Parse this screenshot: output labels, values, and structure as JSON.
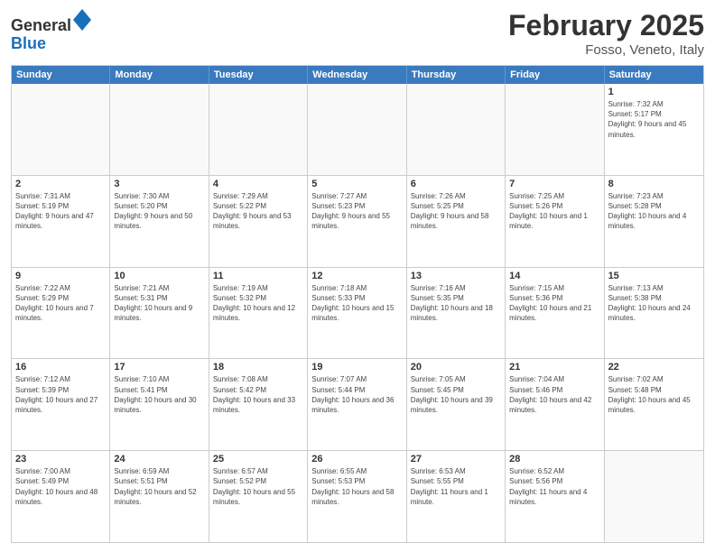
{
  "header": {
    "logo_general": "General",
    "logo_blue": "Blue",
    "title": "February 2025",
    "subtitle": "Fosso, Veneto, Italy"
  },
  "days_of_week": [
    "Sunday",
    "Monday",
    "Tuesday",
    "Wednesday",
    "Thursday",
    "Friday",
    "Saturday"
  ],
  "weeks": [
    [
      {
        "day": "",
        "info": ""
      },
      {
        "day": "",
        "info": ""
      },
      {
        "day": "",
        "info": ""
      },
      {
        "day": "",
        "info": ""
      },
      {
        "day": "",
        "info": ""
      },
      {
        "day": "",
        "info": ""
      },
      {
        "day": "1",
        "info": "Sunrise: 7:32 AM\nSunset: 5:17 PM\nDaylight: 9 hours and 45 minutes."
      }
    ],
    [
      {
        "day": "2",
        "info": "Sunrise: 7:31 AM\nSunset: 5:19 PM\nDaylight: 9 hours and 47 minutes."
      },
      {
        "day": "3",
        "info": "Sunrise: 7:30 AM\nSunset: 5:20 PM\nDaylight: 9 hours and 50 minutes."
      },
      {
        "day": "4",
        "info": "Sunrise: 7:29 AM\nSunset: 5:22 PM\nDaylight: 9 hours and 53 minutes."
      },
      {
        "day": "5",
        "info": "Sunrise: 7:27 AM\nSunset: 5:23 PM\nDaylight: 9 hours and 55 minutes."
      },
      {
        "day": "6",
        "info": "Sunrise: 7:26 AM\nSunset: 5:25 PM\nDaylight: 9 hours and 58 minutes."
      },
      {
        "day": "7",
        "info": "Sunrise: 7:25 AM\nSunset: 5:26 PM\nDaylight: 10 hours and 1 minute."
      },
      {
        "day": "8",
        "info": "Sunrise: 7:23 AM\nSunset: 5:28 PM\nDaylight: 10 hours and 4 minutes."
      }
    ],
    [
      {
        "day": "9",
        "info": "Sunrise: 7:22 AM\nSunset: 5:29 PM\nDaylight: 10 hours and 7 minutes."
      },
      {
        "day": "10",
        "info": "Sunrise: 7:21 AM\nSunset: 5:31 PM\nDaylight: 10 hours and 9 minutes."
      },
      {
        "day": "11",
        "info": "Sunrise: 7:19 AM\nSunset: 5:32 PM\nDaylight: 10 hours and 12 minutes."
      },
      {
        "day": "12",
        "info": "Sunrise: 7:18 AM\nSunset: 5:33 PM\nDaylight: 10 hours and 15 minutes."
      },
      {
        "day": "13",
        "info": "Sunrise: 7:16 AM\nSunset: 5:35 PM\nDaylight: 10 hours and 18 minutes."
      },
      {
        "day": "14",
        "info": "Sunrise: 7:15 AM\nSunset: 5:36 PM\nDaylight: 10 hours and 21 minutes."
      },
      {
        "day": "15",
        "info": "Sunrise: 7:13 AM\nSunset: 5:38 PM\nDaylight: 10 hours and 24 minutes."
      }
    ],
    [
      {
        "day": "16",
        "info": "Sunrise: 7:12 AM\nSunset: 5:39 PM\nDaylight: 10 hours and 27 minutes."
      },
      {
        "day": "17",
        "info": "Sunrise: 7:10 AM\nSunset: 5:41 PM\nDaylight: 10 hours and 30 minutes."
      },
      {
        "day": "18",
        "info": "Sunrise: 7:08 AM\nSunset: 5:42 PM\nDaylight: 10 hours and 33 minutes."
      },
      {
        "day": "19",
        "info": "Sunrise: 7:07 AM\nSunset: 5:44 PM\nDaylight: 10 hours and 36 minutes."
      },
      {
        "day": "20",
        "info": "Sunrise: 7:05 AM\nSunset: 5:45 PM\nDaylight: 10 hours and 39 minutes."
      },
      {
        "day": "21",
        "info": "Sunrise: 7:04 AM\nSunset: 5:46 PM\nDaylight: 10 hours and 42 minutes."
      },
      {
        "day": "22",
        "info": "Sunrise: 7:02 AM\nSunset: 5:48 PM\nDaylight: 10 hours and 45 minutes."
      }
    ],
    [
      {
        "day": "23",
        "info": "Sunrise: 7:00 AM\nSunset: 5:49 PM\nDaylight: 10 hours and 48 minutes."
      },
      {
        "day": "24",
        "info": "Sunrise: 6:59 AM\nSunset: 5:51 PM\nDaylight: 10 hours and 52 minutes."
      },
      {
        "day": "25",
        "info": "Sunrise: 6:57 AM\nSunset: 5:52 PM\nDaylight: 10 hours and 55 minutes."
      },
      {
        "day": "26",
        "info": "Sunrise: 6:55 AM\nSunset: 5:53 PM\nDaylight: 10 hours and 58 minutes."
      },
      {
        "day": "27",
        "info": "Sunrise: 6:53 AM\nSunset: 5:55 PM\nDaylight: 11 hours and 1 minute."
      },
      {
        "day": "28",
        "info": "Sunrise: 6:52 AM\nSunset: 5:56 PM\nDaylight: 11 hours and 4 minutes."
      },
      {
        "day": "",
        "info": ""
      }
    ]
  ]
}
